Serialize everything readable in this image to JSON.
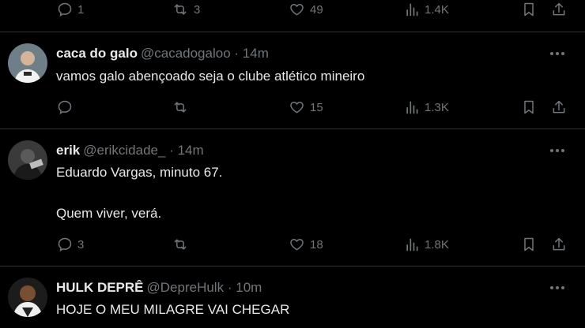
{
  "tweets": [
    {
      "name": "",
      "handle": "",
      "time": "",
      "lines": [],
      "actions": {
        "reply": "1",
        "retweet": "3",
        "like": "49",
        "views": "1.4K"
      }
    },
    {
      "name": "caca do galo",
      "handle": "@cacadogaloo",
      "dot": "·",
      "time": "14m",
      "lines": [
        "vamos galo abençoado seja o clube atlético mineiro"
      ],
      "actions": {
        "reply": "",
        "retweet": "",
        "like": "15",
        "views": "1.3K"
      }
    },
    {
      "name": "erik",
      "handle": "@erikcidade_",
      "dot": "·",
      "time": "14m",
      "lines": [
        "Eduardo Vargas, minuto 67.",
        "Quem viver, verá."
      ],
      "actions": {
        "reply": "3",
        "retweet": "",
        "like": "18",
        "views": "1.8K"
      }
    },
    {
      "name": "HULK DEPRÊ",
      "handle": "@DepreHulk",
      "dot": "·",
      "time": "10m",
      "lines": [
        "HOJE O MEU MILAGRE VAI CHEGAR"
      ]
    }
  ],
  "icons": {
    "reply": "reply-icon",
    "retweet": "retweet-icon",
    "like": "like-icon",
    "views": "views-icon",
    "bookmark": "bookmark-icon",
    "share": "share-icon",
    "more": "more-icon"
  },
  "colors": {
    "background": "#000000",
    "text": "#e7e9ea",
    "muted": "#71767b",
    "divider": "#2f3336"
  }
}
